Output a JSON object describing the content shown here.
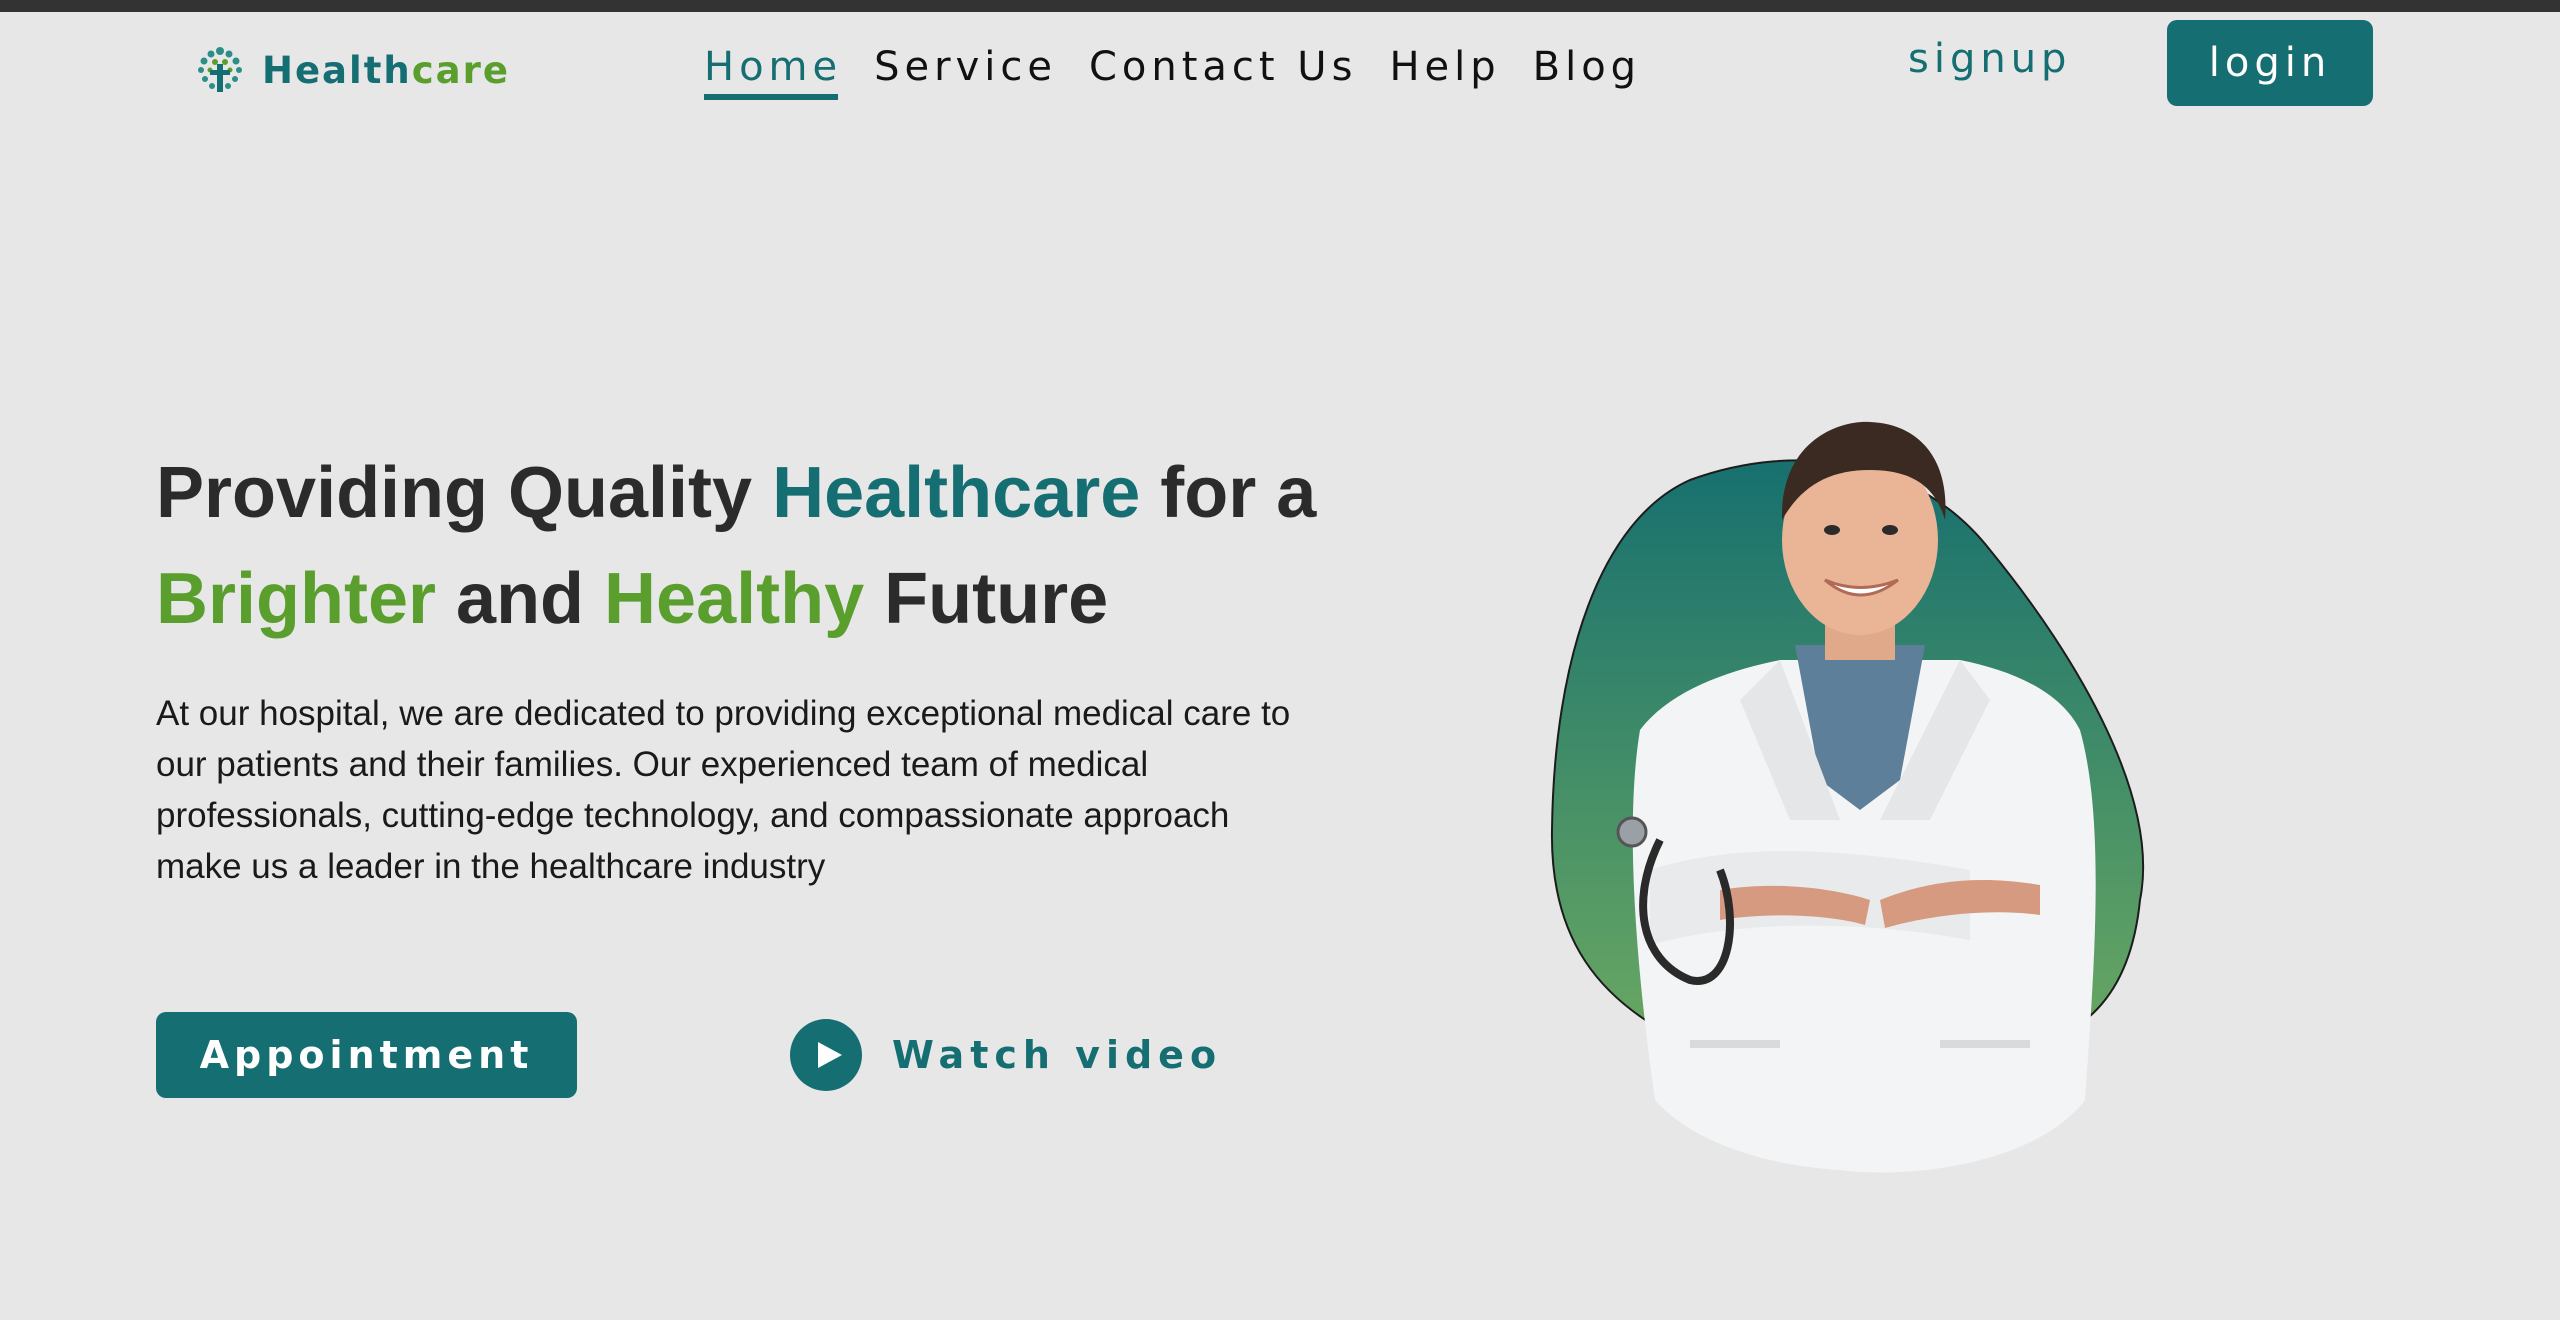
{
  "brand": {
    "name_part1": "Health",
    "name_part2": "care",
    "logo_icon": "tree-cross-logo-icon",
    "primary_color": "#156e72",
    "accent_color": "#5a9f2e"
  },
  "nav": {
    "items": [
      {
        "label": "Home",
        "active": true
      },
      {
        "label": "Service",
        "active": false
      },
      {
        "label": "Contact Us",
        "active": false
      },
      {
        "label": "Help",
        "active": false
      },
      {
        "label": "Blog",
        "active": false
      }
    ],
    "signup_label": "signup",
    "login_label": "login"
  },
  "hero": {
    "title": {
      "part1": "Providing Quality ",
      "part2": "Healthcare",
      "part3": " for a",
      "part4": "Brighter",
      "part5": " and ",
      "part6": "Healthy",
      "part7": " Future"
    },
    "description": "At our hospital, we are dedicated to providing exceptional medical care to our patients and their families. Our experienced team of medical professionals, cutting-edge technology, and compassionate approach make us a leader in the healthcare industry",
    "appointment_label": "Appointment",
    "watch_video_label": "Watch video",
    "play_icon": "play-icon",
    "image": "doctor-photo"
  }
}
